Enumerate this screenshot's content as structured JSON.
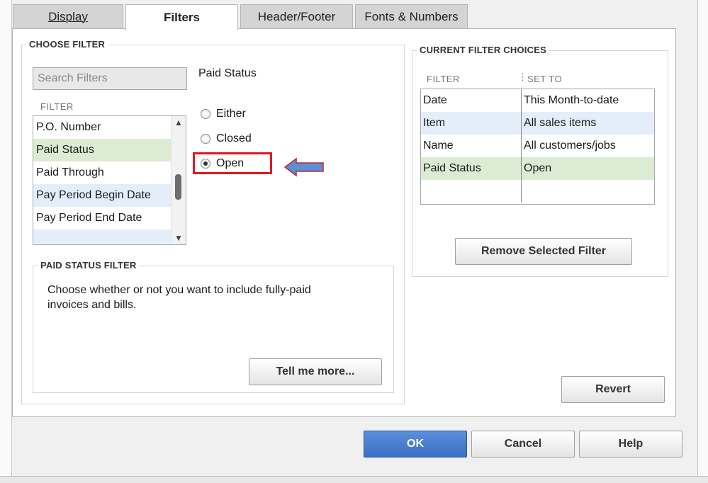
{
  "tabs": [
    {
      "label": "Display",
      "key": "D"
    },
    {
      "label": "Filters",
      "key": "F"
    },
    {
      "label": "Header/Footer",
      "key": "H"
    },
    {
      "label": "Fonts & Numbers",
      "key": "n"
    }
  ],
  "choose_filter": {
    "title": "CHOOSE FILTER",
    "search_placeholder": "Search Filters",
    "filter_header": "FILTER",
    "items": [
      "P.O. Number",
      "Paid Status",
      "Paid Through",
      "Pay Period Begin Date",
      "Pay Period End Date"
    ],
    "selected": "Paid Status"
  },
  "paid_status": {
    "title": "Paid Status",
    "options": [
      "Either",
      "Closed",
      "Open"
    ],
    "selected": "Open"
  },
  "paid_status_filter": {
    "title": "PAID STATUS FILTER",
    "description": "Choose whether or not you want to include fully-paid invoices and bills.",
    "tell_more_label": "Tell me more..."
  },
  "current_filters": {
    "title": "CURRENT FILTER CHOICES",
    "col_filter": "FILTER",
    "col_set_to": "SET TO",
    "rows": [
      {
        "filter": "Date",
        "set_to": "This Month-to-date"
      },
      {
        "filter": "Item",
        "set_to": "All sales items"
      },
      {
        "filter": "Name",
        "set_to": "All customers/jobs"
      },
      {
        "filter": "Paid Status",
        "set_to": "Open"
      }
    ],
    "remove_label": "Remove Selected Filter"
  },
  "buttons": {
    "revert": "Revert",
    "ok": "OK",
    "cancel": "Cancel",
    "help": "Help"
  },
  "colors": {
    "selected_row": "#dcebd4",
    "alt_row": "#e4eefa",
    "highlight_box": "#e0181e",
    "arrow_fill": "#5b8fd6",
    "ok_button": "#3b6fc5"
  }
}
